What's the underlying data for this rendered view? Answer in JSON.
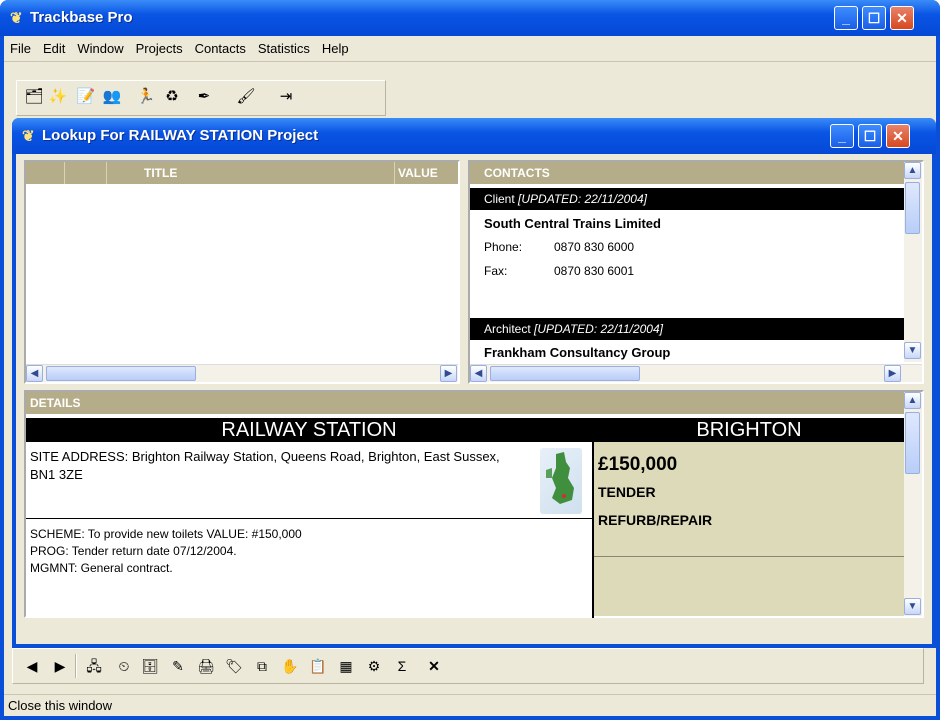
{
  "app": {
    "title": "Trackbase Pro"
  },
  "menu": [
    "File",
    "Edit",
    "Window",
    "Projects",
    "Contacts",
    "Statistics",
    "Help"
  ],
  "lookup": {
    "title": "Lookup For RAILWAY STATION Project"
  },
  "grid": {
    "col_title": "TITLE",
    "col_value": "VALUE"
  },
  "contacts": {
    "header": "CONTACTS",
    "entries": [
      {
        "role": "Client",
        "updated": "[UPDATED: 22/11/2004]",
        "company": "South Central Trains Limited",
        "phone_label": "Phone:",
        "phone": "0870 830 6000",
        "fax_label": "Fax:",
        "fax": "0870 830 6001"
      },
      {
        "role": "Architect",
        "updated": "[UPDATED: 22/11/2004]",
        "company": "Frankham Consultancy Group"
      }
    ]
  },
  "details": {
    "header": "DETAILS",
    "project_name": "RAILWAY STATION",
    "location": "BRIGHTON",
    "site_address": "SITE ADDRESS: Brighton Railway Station, Queens Road, Brighton, East Sussex, BN1 3ZE",
    "scheme": "SCHEME: To provide new toilets  VALUE: #150,000",
    "prog": "PROG: Tender return date 07/12/2004.",
    "mgmnt": "MGMNT: General contract.",
    "value": "£150,000",
    "stage": "TENDER",
    "type": "REFURB/REPAIR"
  },
  "status": {
    "text": "Close this window"
  },
  "colors": {
    "title_blue": "#0a55e4",
    "panel_header": "#b5ad8a",
    "window_bg": "#ece9d8",
    "detail_bg": "#dcdab8"
  }
}
